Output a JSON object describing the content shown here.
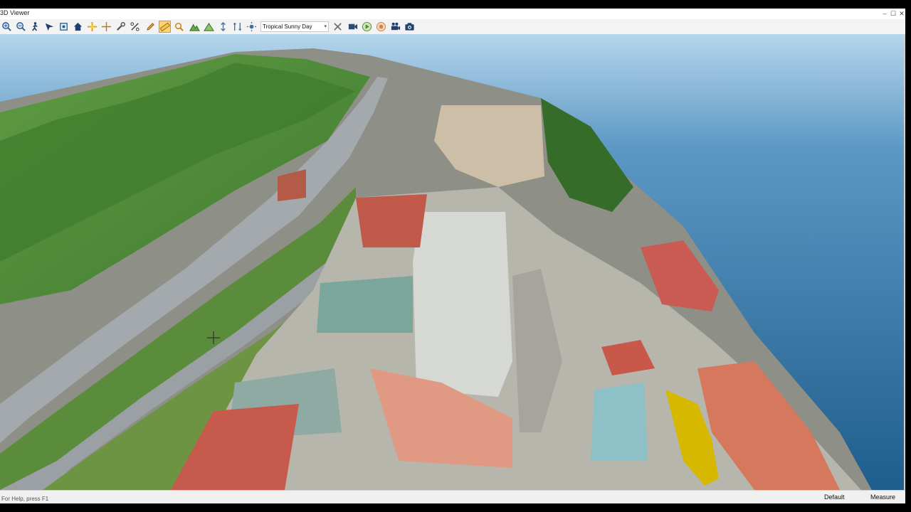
{
  "window": {
    "title": "3D Viewer",
    "minimize_glyph": "–",
    "maximize_glyph": "☐",
    "close_glyph": "✕"
  },
  "toolbar": {
    "preset_value": "Tropical Sunny Day",
    "tools": [
      {
        "name": "zoom-in-icon",
        "active": false
      },
      {
        "name": "zoom-out-icon",
        "active": false
      },
      {
        "name": "walk-icon",
        "active": false
      },
      {
        "name": "fly-icon",
        "active": false
      },
      {
        "name": "fit-view-icon",
        "active": false
      },
      {
        "name": "home-icon",
        "active": false
      },
      {
        "name": "pick-point-icon",
        "active": false
      },
      {
        "name": "crosshair-icon",
        "active": false
      },
      {
        "name": "settings-wrench-icon",
        "active": false
      },
      {
        "name": "percent-icon",
        "active": false
      },
      {
        "name": "pencil-icon",
        "active": false
      },
      {
        "name": "measure-ruler-icon",
        "active": true
      },
      {
        "name": "pan-hand-icon",
        "active": false
      },
      {
        "name": "terrain-icon",
        "active": false
      },
      {
        "name": "terrain-edit-icon",
        "active": false
      },
      {
        "name": "height-icon",
        "active": false
      },
      {
        "name": "height-range-icon",
        "active": false
      },
      {
        "name": "sun-icon",
        "active": false
      }
    ],
    "right_tools": [
      {
        "name": "clear-icon"
      },
      {
        "name": "record-icon"
      },
      {
        "name": "play-icon"
      },
      {
        "name": "stop-icon"
      },
      {
        "name": "video-camera-icon"
      },
      {
        "name": "snapshot-camera-icon"
      }
    ]
  },
  "status": {
    "left": "For Help, press F1",
    "mode": "Default",
    "tool": "Measure"
  },
  "colors": {
    "water": "#2b6c99",
    "sky": "#a9cde6",
    "grass": "#4d8a3a",
    "road": "#9aa0a6",
    "roof_red": "#c8584a"
  }
}
